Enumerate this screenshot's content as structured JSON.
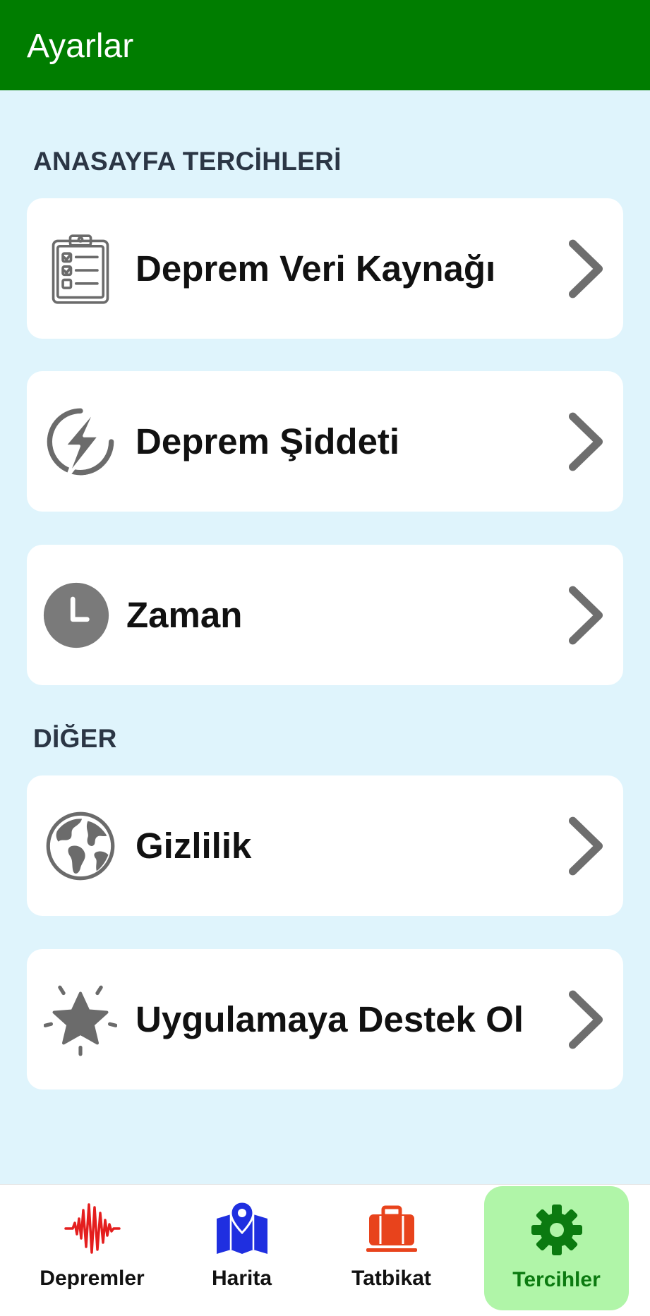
{
  "app_bar": {
    "title": "Ayarlar"
  },
  "sections": {
    "home_prefs": {
      "header": "ANASAYFA TERCİHLERİ"
    },
    "other": {
      "header": "DİĞER"
    }
  },
  "items": [
    {
      "label": "Deprem Veri Kaynağı",
      "icon": "clipboard-checklist-icon"
    },
    {
      "label": "Deprem Şiddeti",
      "icon": "lightning-bolt-circle-icon"
    },
    {
      "label": "Zaman",
      "icon": "clock-icon"
    },
    {
      "label": "Gizlilik",
      "icon": "globe-icon"
    },
    {
      "label": "Uygulamaya Destek Ol",
      "icon": "sparkling-star-icon"
    }
  ],
  "bottom_nav": {
    "items": [
      {
        "label": "Depremler",
        "icon": "seismic-wave-icon",
        "color": "#e41e1e"
      },
      {
        "label": "Harita",
        "icon": "map-pin-icon",
        "color": "#1f2fe0"
      },
      {
        "label": "Tatbikat",
        "icon": "briefcase-icon",
        "color": "#e8431c"
      },
      {
        "label": "Tercihler",
        "icon": "gear-icon",
        "color": "#0b7a10",
        "active": true
      }
    ]
  },
  "colors": {
    "app_bar": "#007d00",
    "background": "#dff4fc",
    "card": "#ffffff",
    "icon_gray": "#707070",
    "active_nav_bg": "#b0f5a8",
    "active_nav_text": "#0b7a10"
  }
}
